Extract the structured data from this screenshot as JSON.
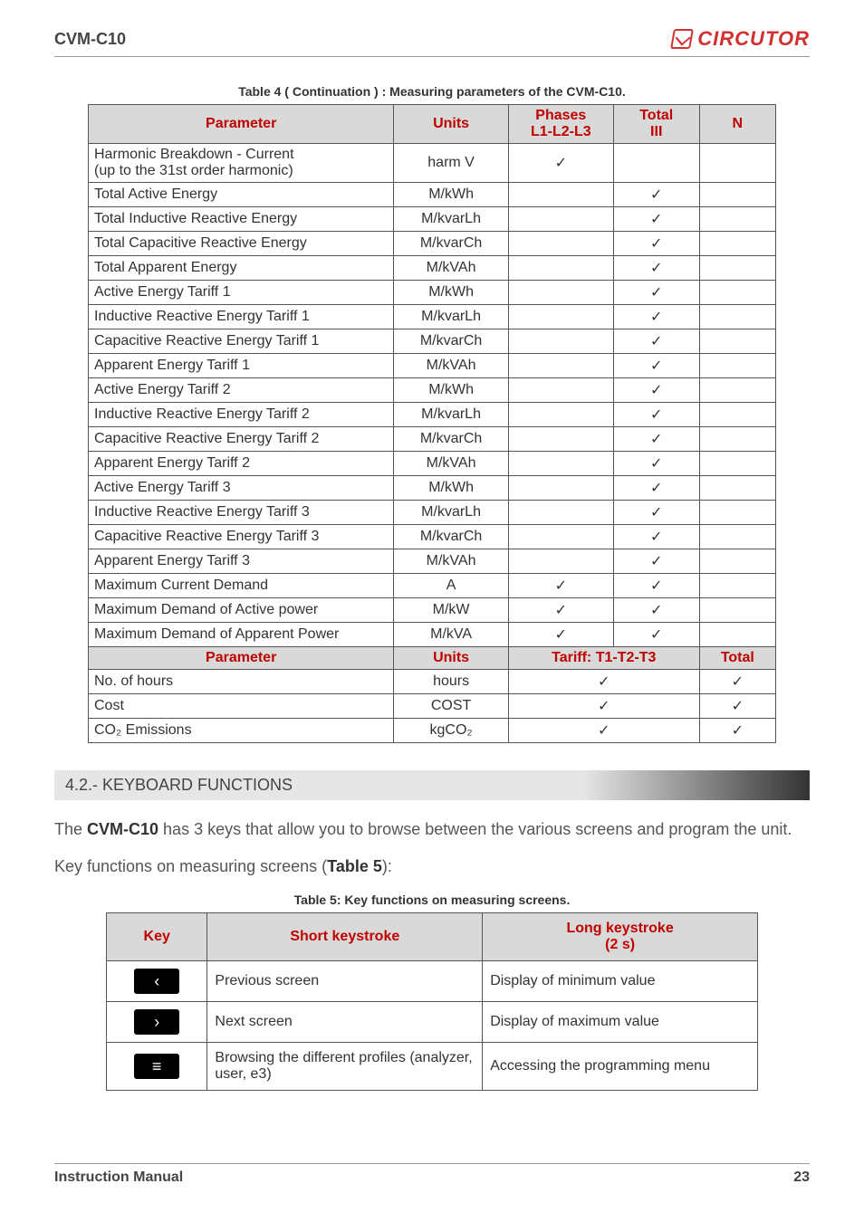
{
  "header": {
    "model": "CVM-C10",
    "brand": "CIRCUTOR"
  },
  "table4": {
    "caption": "Table 4 ( Continuation ) : Measuring parameters of the CVM-C10.",
    "head1": {
      "parameter": "Parameter",
      "units": "Units",
      "phases": "Phases\nL1-L2-L3",
      "total": "Total\nIII",
      "n": "N"
    },
    "rows1": [
      {
        "p": "Harmonic Breakdown - Current\n(up to the 31st order harmonic)",
        "u": "harm V",
        "ph": "✓",
        "t": "",
        "n": ""
      },
      {
        "p": "Total Active Energy",
        "u": "M/kWh",
        "ph": "",
        "t": "✓",
        "n": ""
      },
      {
        "p": "Total Inductive Reactive Energy",
        "u": "M/kvarLh",
        "ph": "",
        "t": "✓",
        "n": ""
      },
      {
        "p": "Total Capacitive Reactive Energy",
        "u": "M/kvarCh",
        "ph": "",
        "t": "✓",
        "n": ""
      },
      {
        "p": "Total Apparent Energy",
        "u": "M/kVAh",
        "ph": "",
        "t": "✓",
        "n": ""
      },
      {
        "p": "Active Energy Tariff 1",
        "u": "M/kWh",
        "ph": "",
        "t": "✓",
        "n": ""
      },
      {
        "p": "Inductive Reactive Energy Tariff 1",
        "u": "M/kvarLh",
        "ph": "",
        "t": "✓",
        "n": ""
      },
      {
        "p": "Capacitive Reactive Energy Tariff 1",
        "u": "M/kvarCh",
        "ph": "",
        "t": "✓",
        "n": ""
      },
      {
        "p": "Apparent Energy Tariff 1",
        "u": "M/kVAh",
        "ph": "",
        "t": "✓",
        "n": ""
      },
      {
        "p": "Active Energy Tariff 2",
        "u": "M/kWh",
        "ph": "",
        "t": "✓",
        "n": ""
      },
      {
        "p": "Inductive Reactive Energy Tariff 2",
        "u": "M/kvarLh",
        "ph": "",
        "t": "✓",
        "n": ""
      },
      {
        "p": "Capacitive Reactive Energy Tariff 2",
        "u": "M/kvarCh",
        "ph": "",
        "t": "✓",
        "n": ""
      },
      {
        "p": "Apparent Energy Tariff 2",
        "u": "M/kVAh",
        "ph": "",
        "t": "✓",
        "n": ""
      },
      {
        "p": "Active Energy Tariff 3",
        "u": "M/kWh",
        "ph": "",
        "t": "✓",
        "n": ""
      },
      {
        "p": "Inductive Reactive Energy Tariff 3",
        "u": "M/kvarLh",
        "ph": "",
        "t": "✓",
        "n": ""
      },
      {
        "p": "Capacitive Reactive Energy Tariff 3",
        "u": "M/kvarCh",
        "ph": "",
        "t": "✓",
        "n": ""
      },
      {
        "p": "Apparent Energy Tariff 3",
        "u": "M/kVAh",
        "ph": "",
        "t": "✓",
        "n": ""
      },
      {
        "p": "Maximum Current Demand",
        "u": "A",
        "ph": "✓",
        "t": "✓",
        "n": ""
      },
      {
        "p": "Maximum Demand of Active power",
        "u": "M/kW",
        "ph": "✓",
        "t": "✓",
        "n": ""
      },
      {
        "p": "Maximum Demand of Apparent Power",
        "u": "M/kVA",
        "ph": "✓",
        "t": "✓",
        "n": ""
      }
    ],
    "head2": {
      "parameter": "Parameter",
      "units": "Units",
      "tariff": "Tariff: T1-T2-T3",
      "total": "Total"
    },
    "rows2": [
      {
        "p": "No. of hours",
        "u": "hours",
        "tr": "✓",
        "t": "✓"
      },
      {
        "p": "Cost",
        "u": "COST",
        "tr": "✓",
        "t": "✓"
      },
      {
        "p": "CO₂ Emissions",
        "u": "kgCO₂",
        "tr": "✓",
        "t": "✓"
      }
    ]
  },
  "section": {
    "title": "4.2.- KEYBOARD FUNCTIONS"
  },
  "body": {
    "p1a": "The ",
    "p1b": "CVM-C10",
    "p1c": " has 3 keys that allow you to browse between the various screens and program the unit.",
    "p2a": "Key functions on measuring screens (",
    "p2b": "Table 5",
    "p2c": "):"
  },
  "table5": {
    "caption": "Table 5: Key functions on measuring screens.",
    "head": {
      "key": "Key",
      "short": "Short keystroke",
      "long": "Long keystroke\n(2 s)"
    },
    "rows": [
      {
        "icon": "‹",
        "short": "Previous screen",
        "long": "Display of minimum value"
      },
      {
        "icon": "›",
        "short": "Next screen",
        "long": "Display of maximum value"
      },
      {
        "icon": "≡",
        "short": "Browsing the different profiles (analyzer, user, e3)",
        "long": "Accessing the programming menu"
      }
    ]
  },
  "footer": {
    "left": "Instruction Manual",
    "right": "23"
  }
}
